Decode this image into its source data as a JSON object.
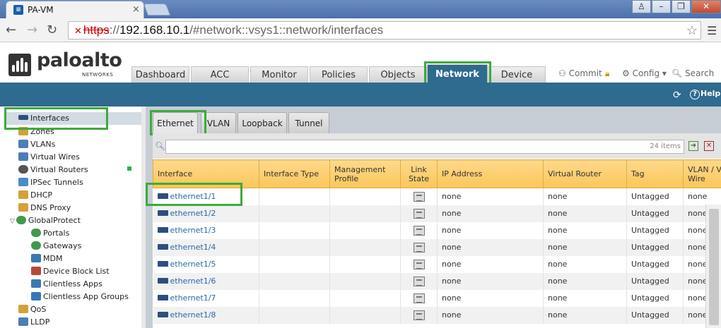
{
  "browser": {
    "tab_title": "PA-VM",
    "url_scheme": "https",
    "url_host": "192.168.10.1",
    "url_path": "/#network::vsys1::network/interfaces"
  },
  "app": {
    "logo_text": "paloalto",
    "logo_sub": "NETWORKS",
    "tabs": [
      {
        "label": "Dashboard"
      },
      {
        "label": "ACC"
      },
      {
        "label": "Monitor"
      },
      {
        "label": "Policies"
      },
      {
        "label": "Objects"
      },
      {
        "label": "Network"
      },
      {
        "label": "Device"
      }
    ],
    "active_tab": "Network",
    "actions": {
      "commit": "Commit",
      "config": "Config",
      "search": "Search"
    },
    "help_label": "Help"
  },
  "sidebar": {
    "items": [
      {
        "label": "Interfaces"
      },
      {
        "label": "Zones"
      },
      {
        "label": "VLANs"
      },
      {
        "label": "Virtual Wires"
      },
      {
        "label": "Virtual Routers"
      },
      {
        "label": "IPSec Tunnels"
      },
      {
        "label": "DHCP"
      },
      {
        "label": "DNS Proxy"
      },
      {
        "label": "GlobalProtect"
      },
      {
        "label": "Portals"
      },
      {
        "label": "Gateways"
      },
      {
        "label": "MDM"
      },
      {
        "label": "Device Block List"
      },
      {
        "label": "Clientless Apps"
      },
      {
        "label": "Clientless App Groups"
      },
      {
        "label": "QoS"
      },
      {
        "label": "LLDP"
      }
    ],
    "selected": "Interfaces"
  },
  "subtabs": [
    {
      "label": "Ethernet"
    },
    {
      "label": "VLAN"
    },
    {
      "label": "Loopback"
    },
    {
      "label": "Tunnel"
    }
  ],
  "filter": {
    "count": "24 items"
  },
  "table": {
    "headers": {
      "interface": "Interface",
      "interface_type": "Interface Type",
      "mgmt_line1": "Management",
      "mgmt_line2": "Profile",
      "link_line1": "Link",
      "link_line2": "State",
      "ip": "IP Address",
      "vr": "Virtual Router",
      "tag": "Tag",
      "vlan_line1": "VLAN / Virtual",
      "vlan_line2": "Wire"
    },
    "rows": [
      {
        "iface": "ethernet1/1",
        "ip": "none",
        "vr": "none",
        "tag": "Untagged",
        "vlan": "none"
      },
      {
        "iface": "ethernet1/2",
        "ip": "none",
        "vr": "none",
        "tag": "Untagged",
        "vlan": "none"
      },
      {
        "iface": "ethernet1/3",
        "ip": "none",
        "vr": "none",
        "tag": "Untagged",
        "vlan": "none"
      },
      {
        "iface": "ethernet1/4",
        "ip": "none",
        "vr": "none",
        "tag": "Untagged",
        "vlan": "none"
      },
      {
        "iface": "ethernet1/5",
        "ip": "none",
        "vr": "none",
        "tag": "Untagged",
        "vlan": "none"
      },
      {
        "iface": "ethernet1/6",
        "ip": "none",
        "vr": "none",
        "tag": "Untagged",
        "vlan": "none"
      },
      {
        "iface": "ethernet1/7",
        "ip": "none",
        "vr": "none",
        "tag": "Untagged",
        "vlan": "none"
      },
      {
        "iface": "ethernet1/8",
        "ip": "none",
        "vr": "none",
        "tag": "Untagged",
        "vlan": "none"
      }
    ]
  }
}
